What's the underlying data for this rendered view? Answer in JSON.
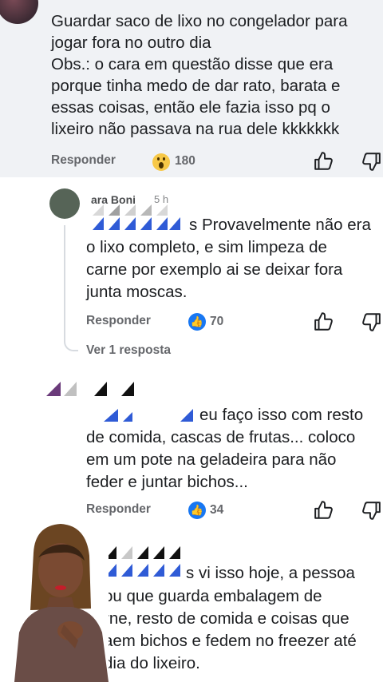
{
  "top_comment": {
    "lines": [
      "Guardar saco de lixo no congelador para",
      "jogar fora no outro dia",
      "Obs.: o cara em questão disse que era",
      "porque tinha medo de dar rato, barata e",
      "essas coisas, então ele fazia isso pq o",
      "lixeiro não passava na rua dele kkkkkkk"
    ],
    "reply_label": "Responder",
    "reaction_icon": "wow-reaction-icon",
    "reaction_count": "180"
  },
  "reply_1": {
    "author_fragment": "ara Boni",
    "time": "5 h",
    "lines": [
      "s Provavelmente não era",
      "o lixo completo, e sim limpeza de",
      "carne por exemplo ai se deixar fora",
      "junta moscas."
    ],
    "reply_label": "Responder",
    "reaction_icon": "like-reaction-icon",
    "reaction_count": "70",
    "see_replies": "Ver 1 resposta"
  },
  "reply_2": {
    "lines": [
      "eu faço isso com resto",
      "de comida, cascas de frutas... coloco",
      "em um pote na geladeira para não",
      "feder e juntar bichos..."
    ],
    "reply_label": "Responder",
    "reaction_icon": "like-reaction-icon",
    "reaction_count": "34"
  },
  "reply_3": {
    "lines": [
      "s vi isso hoje, a pessoa",
      "ou que guarda embalagem de",
      "rne, resto de comida e coisas que",
      "aem bichos e fedem no freezer até",
      "dia do lixeiro."
    ]
  },
  "colors": {
    "top_comment_bg": "#f0f2f5",
    "text": "#1c1e21",
    "muted": "#65676b",
    "like_blue": "#1877f2",
    "censor_blue": "#2f5bd6"
  }
}
